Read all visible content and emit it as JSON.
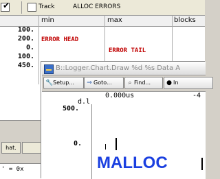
{
  "back_window": {
    "toolbar": {
      "checkbox_checked": "✔",
      "track_label": "Track",
      "alloc_label": "ALLOC ERRORS"
    },
    "columns": {
      "min": "min",
      "max": "max",
      "blocks": "blocks"
    },
    "row_values": [
      "100.",
      "200.",
      "0.",
      "100.",
      "450."
    ],
    "errors": {
      "head": "ERROR HEAD",
      "tail": "ERROR TAIL"
    }
  },
  "side": {
    "button_label": "hat.",
    "field_text": "' = 0x"
  },
  "front_window": {
    "title": "B::Logger.Chart.Draw %d %s Data A",
    "toolbar": {
      "setup": "Setup...",
      "goto": "Goto...",
      "find": "Find...",
      "more": "In"
    },
    "ruler": {
      "start": "0.000us",
      "end": "-4",
      "axis_label": "d.l"
    },
    "chart": {
      "y_ticks": [
        "500.",
        "0."
      ],
      "label": "MALLOC"
    }
  },
  "icons": {
    "setup": "wrench-icon",
    "goto": "goto-icon",
    "find": "find-icon",
    "more": "info-icon"
  },
  "colors": {
    "error": "#c00000",
    "malloc": "#1a3fe0"
  }
}
